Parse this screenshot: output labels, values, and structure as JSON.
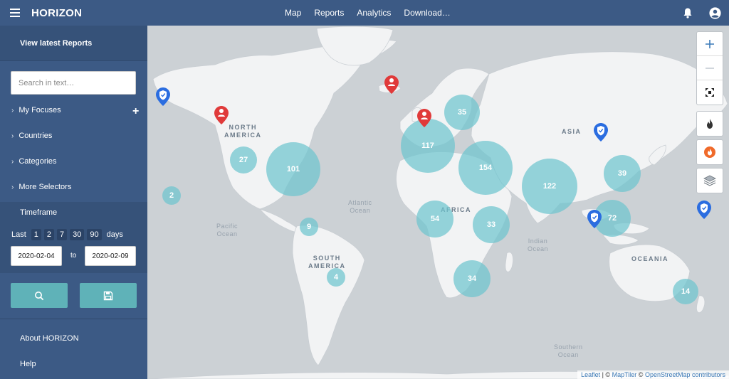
{
  "app": {
    "title": "HORIZON"
  },
  "nav": {
    "map": "Map",
    "reports": "Reports",
    "analytics": "Analytics",
    "download": "Download…"
  },
  "sidebar": {
    "latest": "View latest Reports",
    "search_placeholder": "Search in text…",
    "items": [
      "My Focuses",
      "Countries",
      "Categories",
      "More Selectors"
    ],
    "timeframe": "Timeframe",
    "last_label": "Last",
    "days_label": "days",
    "presets": [
      "1",
      "2",
      "7",
      "30",
      "90"
    ],
    "date_from": "2020-02-04",
    "to_label": "to",
    "date_to": "2020-02-09",
    "about": "About HORIZON",
    "help": "Help"
  },
  "map": {
    "continents": {
      "north_america": "NORTH\nAMERICA",
      "south_america": "SOUTH\nAMERICA",
      "africa": "AFRICA",
      "asia": "ASIA",
      "oceania": "OCEANIA"
    },
    "oceans": {
      "atlantic": "Atlantic\nOcean",
      "pacific": "Pacific\nOcean",
      "indian": "Indian\nOcean",
      "southern": "Southern\nOcean"
    },
    "clusters": [
      "2",
      "27",
      "101",
      "9",
      "4",
      "117",
      "35",
      "154",
      "54",
      "33",
      "34",
      "122",
      "39",
      "72",
      "14"
    ],
    "attribution": {
      "leaflet": "Leaflet",
      "sep": " | © ",
      "maptiler": "MapTiler",
      "mid": " © ",
      "osm": "OpenStreetMap contributors"
    }
  },
  "colors": {
    "header": "#3c5a85",
    "sidebar_dark": "#365279",
    "cluster": "#6ec5cf",
    "pin_red": "#e03a3a",
    "pin_blue": "#2b6de0",
    "button": "#5fb2b8"
  }
}
